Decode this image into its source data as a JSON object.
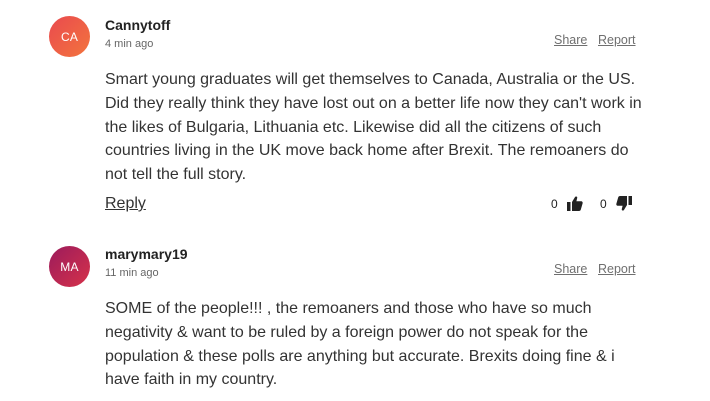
{
  "comments": [
    {
      "initials": "CA",
      "username": "Cannytoff",
      "time": "4 min ago",
      "share": "Share",
      "report": "Report",
      "text": "Smart young graduates will get themselves to Canada, Australia or the US. Did they really think they have lost out on a better life now they can't work in the likes of Bulgaria, Lithuania etc. Likewise did all the citizens of such countries living in the UK move back home after Brexit. The remoaners do not tell the full story.",
      "reply": "Reply",
      "likes": "0",
      "dislikes": "0"
    },
    {
      "initials": "MA",
      "username": "marymary19",
      "time": "11 min ago",
      "share": "Share",
      "report": "Report",
      "text": "SOME of the people!!! , the remoaners and those who have so much negativity & want to be ruled by a foreign power do not speak for the population & these polls are anything but accurate. Brexits doing fine & i have faith in my country."
    }
  ],
  "colors": {
    "avatar_ca": "#f0643f",
    "avatar_ma": "#b8234f",
    "action_text": "#6f6f6f"
  },
  "icons": {
    "like": "thumbs-up-icon",
    "dislike": "thumbs-down-icon"
  }
}
